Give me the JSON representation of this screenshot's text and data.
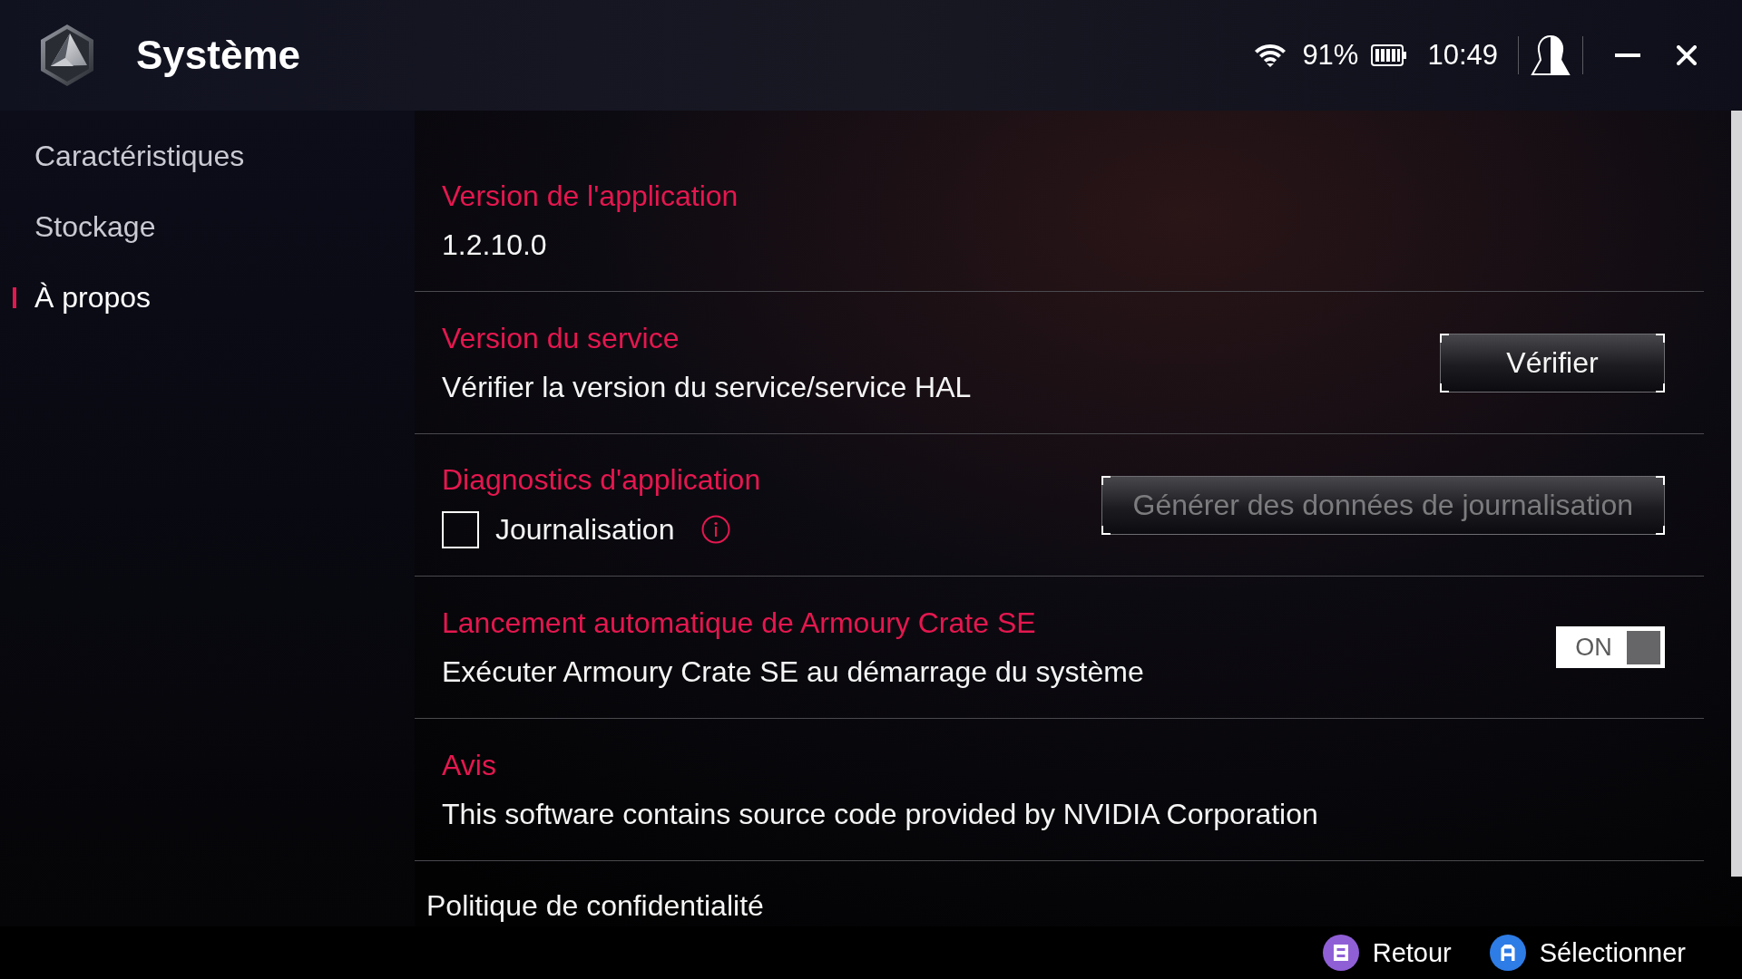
{
  "window": {
    "title": "Système"
  },
  "status_bar": {
    "battery": "91%",
    "time": "10:49"
  },
  "sidebar": {
    "items": [
      {
        "label": "Caractéristiques",
        "selected": false
      },
      {
        "label": "Stockage",
        "selected": false
      },
      {
        "label": "À propos",
        "selected": true
      }
    ]
  },
  "sections": [
    {
      "kind": "info",
      "title": "Version de l'application",
      "value": "1.2.10.0"
    },
    {
      "kind": "button",
      "title": "Version du service",
      "description": "Vérifier la version du service/service HAL",
      "button": {
        "label": "Vérifier",
        "disabled": false
      }
    },
    {
      "kind": "checkbox",
      "title": "Diagnostics d'application",
      "checkbox": {
        "label": "Journalisation",
        "checked": false
      },
      "button": {
        "label": "Générer des données de journalisation",
        "disabled": true
      }
    },
    {
      "kind": "toggle",
      "title": "Lancement automatique de Armoury Crate SE",
      "description": "Exécuter Armoury Crate SE au démarrage du système",
      "toggle": {
        "label": "ON",
        "on": true
      }
    },
    {
      "kind": "info",
      "title": "Avis",
      "value": "This software contains source code provided by NVIDIA Corporation"
    },
    {
      "kind": "link",
      "title": "Politique de confidentialité"
    }
  ],
  "footer": {
    "actions": [
      {
        "kind": "b",
        "label": "Retour",
        "color": "#8f5fd6"
      },
      {
        "kind": "a",
        "label": "Sélectionner",
        "color": "#2e7ce6"
      }
    ]
  }
}
